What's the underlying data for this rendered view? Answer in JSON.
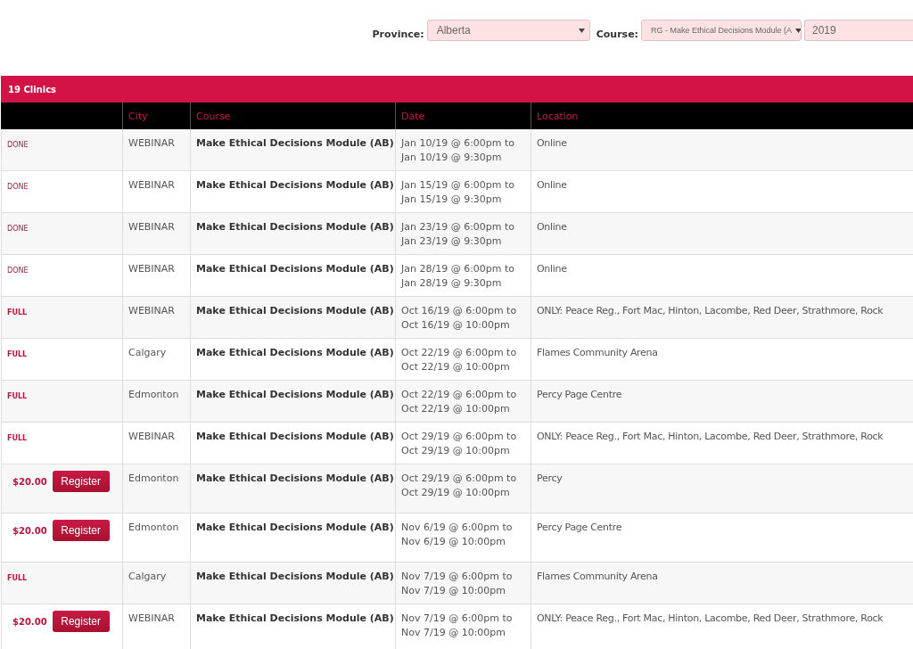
{
  "filters": {
    "province": {
      "label": "Province:",
      "value": "Alberta"
    },
    "course": {
      "label": "Course:",
      "value": "RG - Make Ethical Decisions Module (A"
    },
    "year": {
      "value": "2019"
    }
  },
  "panel": {
    "title": "19 Clinics"
  },
  "table": {
    "columns": [
      "",
      "City",
      "Course",
      "Date",
      "Location"
    ],
    "rows": [
      {
        "kind": "done",
        "status": "DONE",
        "city": "WEBINAR",
        "course": "Make Ethical Decisions Module (AB)",
        "date": [
          "Jan 10/19 @ 6:00pm to",
          "Jan 10/19 @ 9:30pm"
        ],
        "location": "Online"
      },
      {
        "kind": "done",
        "status": "DONE",
        "city": "WEBINAR",
        "course": "Make Ethical Decisions Module (AB)",
        "date": [
          "Jan 15/19 @ 6:00pm to",
          "Jan 15/19 @ 9:30pm"
        ],
        "location": "Online"
      },
      {
        "kind": "done",
        "status": "DONE",
        "city": "WEBINAR",
        "course": "Make Ethical Decisions Module (AB)",
        "date": [
          "Jan 23/19 @ 6:00pm to",
          "Jan 23/19 @ 9:30pm"
        ],
        "location": "Online"
      },
      {
        "kind": "done",
        "status": "DONE",
        "city": "WEBINAR",
        "course": "Make Ethical Decisions Module (AB)",
        "date": [
          "Jan 28/19 @ 6:00pm to",
          "Jan 28/19 @ 9:30pm"
        ],
        "location": "Online"
      },
      {
        "kind": "full",
        "status": "FULL",
        "city": "WEBINAR",
        "course": "Make Ethical Decisions Module (AB)",
        "date": [
          "Oct 16/19 @ 6:00pm to",
          "Oct 16/19 @ 10:00pm"
        ],
        "location": "ONLY: Peace Reg., Fort Mac, Hinton, Lacombe, Red Deer, Strathmore, Rock"
      },
      {
        "kind": "full",
        "status": "FULL",
        "city": "Calgary",
        "course": "Make Ethical Decisions Module (AB)",
        "date": [
          "Oct 22/19 @ 6:00pm to",
          "Oct 22/19 @ 10:00pm"
        ],
        "location": "Flames Community Arena"
      },
      {
        "kind": "full",
        "status": "FULL",
        "city": "Edmonton",
        "course": "Make Ethical Decisions Module (AB)",
        "date": [
          "Oct 22/19 @ 6:00pm to",
          "Oct 22/19 @ 10:00pm"
        ],
        "location": "Percy Page Centre"
      },
      {
        "kind": "full",
        "status": "FULL",
        "city": "WEBINAR",
        "course": "Make Ethical Decisions Module (AB)",
        "date": [
          "Oct 29/19 @ 6:00pm to",
          "Oct 29/19 @ 10:00pm"
        ],
        "location": "ONLY: Peace Reg., Fort Mac, Hinton, Lacombe, Red Deer, Strathmore, Rock"
      },
      {
        "kind": "register",
        "status": "$20.00",
        "button": "Register",
        "city": "Edmonton",
        "course": "Make Ethical Decisions Module (AB)",
        "date": [
          "Oct 29/19 @ 6:00pm to",
          "Oct 29/19 @ 10:00pm"
        ],
        "location": "Percy"
      },
      {
        "kind": "register",
        "status": "$20.00",
        "button": "Register",
        "city": "Edmonton",
        "course": "Make Ethical Decisions Module (AB)",
        "date": [
          "Nov 6/19 @ 6:00pm to",
          "Nov 6/19 @ 10:00pm"
        ],
        "location": "Percy Page Centre"
      },
      {
        "kind": "full",
        "status": "FULL",
        "city": "Calgary",
        "course": "Make Ethical Decisions Module (AB)",
        "date": [
          "Nov 7/19 @ 6:00pm to",
          "Nov 7/19 @ 10:00pm"
        ],
        "location": "Flames Community Arena"
      },
      {
        "kind": "register",
        "status": "$20.00",
        "button": "Register",
        "city": "WEBINAR",
        "course": "Make Ethical Decisions Module (AB)",
        "date": [
          "Nov 7/19 @ 6:00pm to",
          "Nov 7/19 @ 10:00pm"
        ],
        "location": "ONLY: Peace Reg., Fort Mac, Hinton, Lacombe, Red Deer, Strathmore, Rock"
      }
    ]
  }
}
